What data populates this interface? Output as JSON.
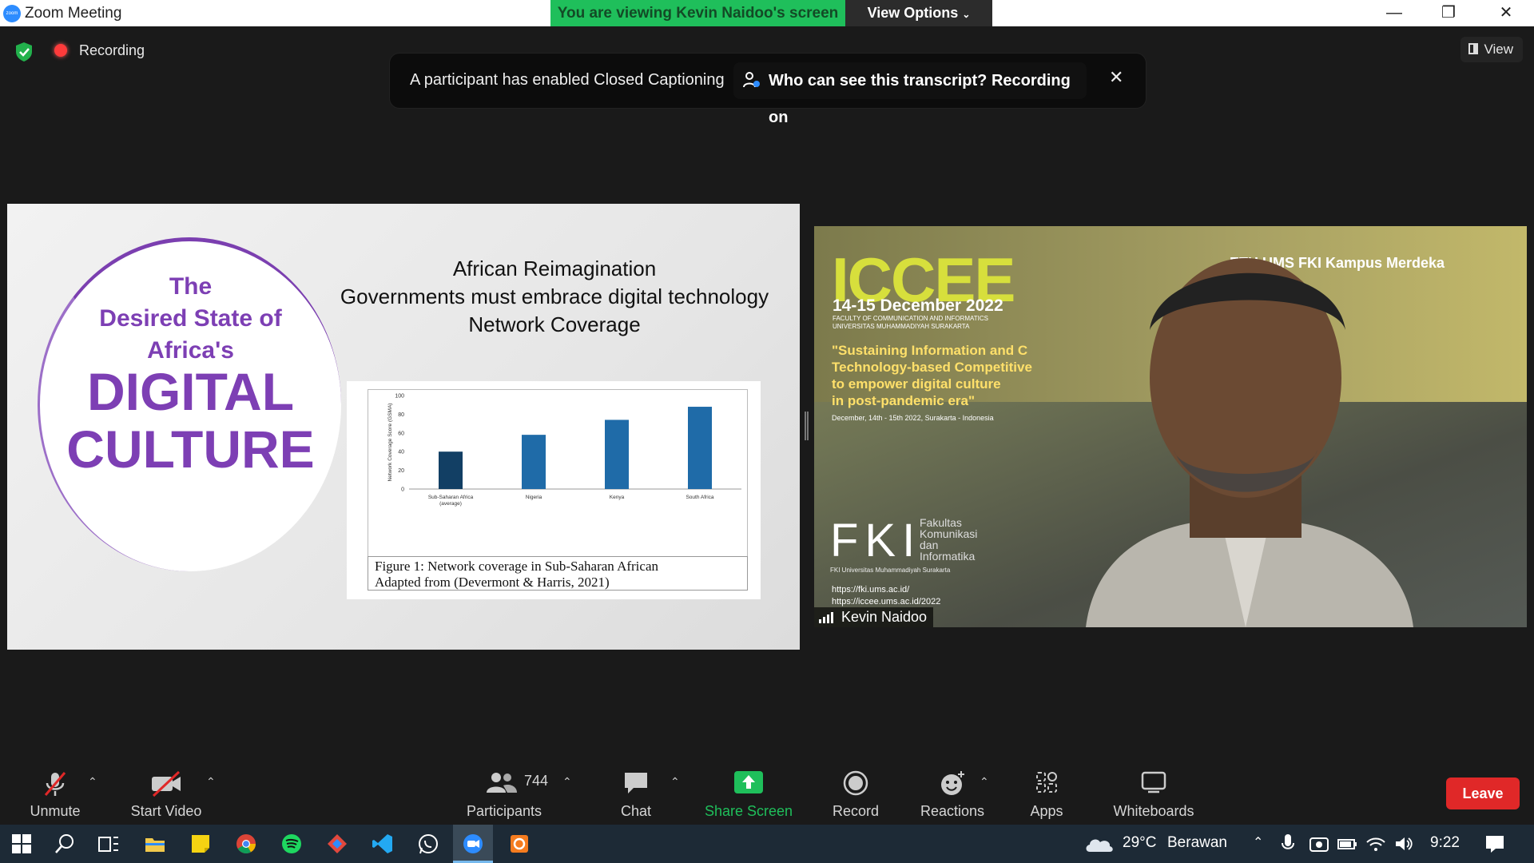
{
  "window": {
    "title": "Zoom Meeting",
    "viewing_banner": "You are viewing Kevin Naidoo's screen",
    "view_options": "View Options",
    "view_button": "View"
  },
  "status": {
    "recording_label": "Recording"
  },
  "caption_banner": {
    "message": "A participant has enabled Closed Captioning",
    "transcript_link": "Who can see this transcript? Recording on"
  },
  "slide": {
    "title_lines": [
      "African Reimagination",
      "Governments must embrace digital technology",
      "Network Coverage"
    ],
    "logo_lines": [
      "The",
      "Desired State of",
      "Africa's",
      "DIGITAL",
      "CULTURE"
    ],
    "figure_caption": [
      "Figure 1: Network coverage in Sub-Saharan African",
      "Adapted from (Devermont & Harris, 2021)"
    ]
  },
  "chart_data": {
    "type": "bar",
    "categories": [
      "Sub-Saharan Africa (average)",
      "Nigeria",
      "Kenya",
      "South Africa"
    ],
    "values": [
      40,
      58,
      74,
      88
    ],
    "ylabel": "Network Coverage Score (GSMA)",
    "ylim": [
      0,
      100
    ],
    "yticks": [
      0,
      20,
      40,
      60,
      80,
      100
    ],
    "colors": [
      "#123f64",
      "#1f6ba8",
      "#1f6ba8",
      "#1f6ba8"
    ]
  },
  "video": {
    "participant_name": "Kevin Naidoo",
    "event_name": "ICCEE",
    "event_dates": "14-15 December 2022",
    "faculty": [
      "FACULTY OF COMMUNICATION AND INFORMATICS",
      "UNIVERSITAS MUHAMMADIYAH SURAKARTA"
    ],
    "theme": [
      "\"Sustaining Information and C",
      "Technology-based Competitive",
      "to empower digital culture",
      "in post-pandemic era\""
    ],
    "event_place": "December, 14th - 15th 2022, Surakarta - Indonesia",
    "logos": "ETH   UMS   FKI   Kampus Merdeka",
    "fki_letters": "FKI",
    "fki_sub": [
      "Fakultas",
      "Komunikasi",
      "dan",
      "Informatika"
    ],
    "fki_line": "FKI Universitas Muhammadiyah Surakarta",
    "urls": [
      "https://fki.ums.ac.id/",
      "https://iccee.ums.ac.id/2022"
    ]
  },
  "toolbar": {
    "unmute": "Unmute",
    "start_video": "Start Video",
    "participants": "Participants",
    "participant_count": "744",
    "chat": "Chat",
    "share_screen": "Share Screen",
    "record": "Record",
    "reactions": "Reactions",
    "apps": "Apps",
    "whiteboards": "Whiteboards",
    "leave": "Leave",
    "share_color": "#1fbf5b",
    "leave_color": "#e02828"
  },
  "taskbar": {
    "weather_temp": "29°C",
    "weather_desc": "Berawan",
    "time": "9:22"
  }
}
